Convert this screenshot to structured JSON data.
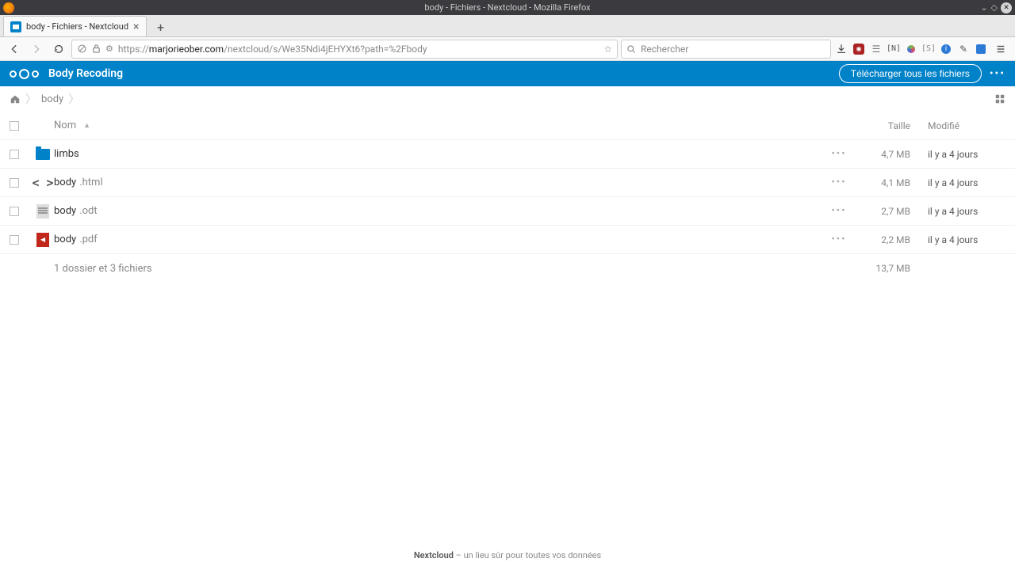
{
  "window": {
    "title": "body - Fichiers - Nextcloud - Mozilla Firefox"
  },
  "tab": {
    "title": "body - Fichiers - Nextcloud"
  },
  "url": {
    "scheme": "https://",
    "host": "marjorieober.com",
    "path": "/nextcloud/s/We35Ndi4jEHYXt6?path=%2Fbody"
  },
  "search": {
    "placeholder": "Rechercher"
  },
  "nc": {
    "title": "Body Recoding",
    "download_label": "Télécharger tous les fichiers"
  },
  "breadcrumb": {
    "current": "body"
  },
  "columns": {
    "name": "Nom",
    "size": "Taille",
    "modified": "Modifié"
  },
  "files": [
    {
      "name": "limbs",
      "ext": "",
      "type": "folder",
      "size": "4,7 MB",
      "modified": "il y a 4 jours"
    },
    {
      "name": "body",
      "ext": ".html",
      "type": "code",
      "size": "4,1 MB",
      "modified": "il y a 4 jours"
    },
    {
      "name": "body",
      "ext": ".odt",
      "type": "doc",
      "size": "2,7 MB",
      "modified": "il y a 4 jours"
    },
    {
      "name": "body",
      "ext": ".pdf",
      "type": "pdf",
      "size": "2,2 MB",
      "modified": "il y a 4 jours"
    }
  ],
  "summary": {
    "text": "1 dossier et 3 fichiers",
    "size": "13,7 MB"
  },
  "footer": {
    "brand": "Nextcloud",
    "rest": " – un lieu sûr pour toutes vos données"
  }
}
